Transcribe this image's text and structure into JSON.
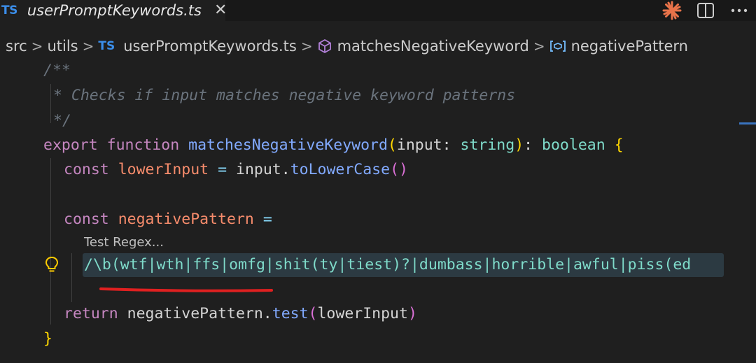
{
  "tab": {
    "lang_badge": "TS",
    "title": "userPromptKeywords.ts",
    "close": "✕"
  },
  "toolbar": {
    "icons": [
      "sparkle-icon",
      "split-editor-icon",
      "more-actions-icon"
    ]
  },
  "breadcrumb": {
    "items": [
      "src",
      "utils",
      "userPromptKeywords.ts",
      "matchesNegativeKeyword",
      "negativePattern"
    ],
    "separator": ">",
    "file_badge": "TS"
  },
  "code": {
    "comment_open": "/**",
    "comment_star": "*",
    "comment_text": "Checks if input matches negative keyword patterns",
    "comment_close": "*/",
    "kw_export": "export",
    "kw_function": "function",
    "fn_name": "matchesNegativeKeyword",
    "paren_open": "(",
    "param": "input",
    "colon": ":",
    "type_string": "string",
    "paren_close": ")",
    "type_boolean": "boolean",
    "brace_open": "{",
    "kw_const": "const",
    "var_lower": "lowerInput",
    "eq": "=",
    "obj_input": "input",
    "dot": ".",
    "method_lower": "toLowerCase",
    "call_parens": "()",
    "var_pattern": "negativePattern",
    "codelens": "Test Regex...",
    "regex": "/\\b(wtf|wth|ffs|omfg|shit(ty|tiest)?|dumbass|horrible|awful|piss(ed",
    "kw_return": "return",
    "ret_obj": "negativePattern",
    "method_test": "test",
    "ret_arg": "lowerInput",
    "brace_close": "}"
  },
  "colors": {
    "keyword": "#c586c0",
    "function": "#82aaff",
    "variable": "#f78c6c",
    "type": "#7fdbca",
    "annotation": "#e02020"
  }
}
